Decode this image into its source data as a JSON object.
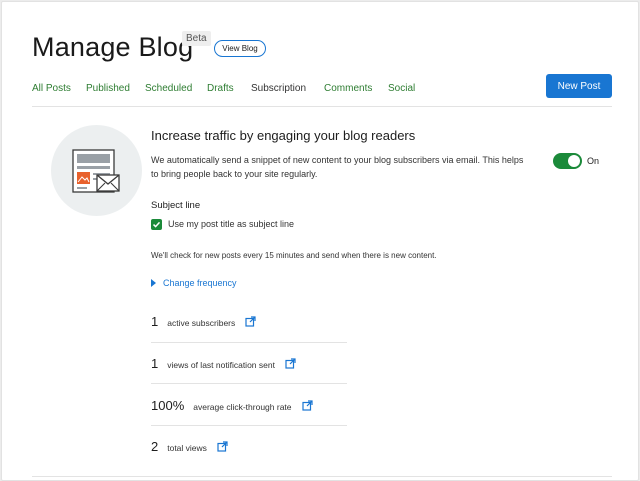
{
  "header": {
    "title": "Manage Blog",
    "badge": "Beta",
    "view_blog_label": "View Blog",
    "new_post_label": "New Post"
  },
  "tabs": [
    {
      "label": "All Posts",
      "active": false
    },
    {
      "label": "Published",
      "active": false
    },
    {
      "label": "Scheduled",
      "active": false
    },
    {
      "label": "Drafts",
      "active": false
    },
    {
      "label": "Subscription",
      "active": true
    },
    {
      "label": "Comments",
      "active": false
    },
    {
      "label": "Social",
      "active": false
    }
  ],
  "subscription": {
    "heading": "Increase traffic by engaging your blog readers",
    "description": "We automatically send a snippet of new content to your blog subscribers via email. This helps to bring people back to your site regularly.",
    "toggle_state": "On",
    "subject_line_label": "Subject line",
    "checkbox_label": "Use my post title as subject line",
    "checkbox_checked": true,
    "frequency_note": "We'll check for new posts every 15 minutes and send when there is new content.",
    "change_frequency_label": "Change frequency"
  },
  "stats": [
    {
      "value": "1",
      "label": "active subscribers"
    },
    {
      "value": "1",
      "label": "views of last notification sent"
    },
    {
      "value": "100%",
      "label": "average click-through rate"
    },
    {
      "value": "2",
      "label": "total views"
    }
  ],
  "icons": {
    "external_link": "external-link-icon",
    "illustration": "newsletter-envelope-icon",
    "check": "check-icon",
    "disclosure": "caret-right-icon"
  },
  "colors": {
    "accent_green": "#1b8a3a",
    "tab_green": "#2e7d32",
    "primary_blue": "#1976d2"
  }
}
